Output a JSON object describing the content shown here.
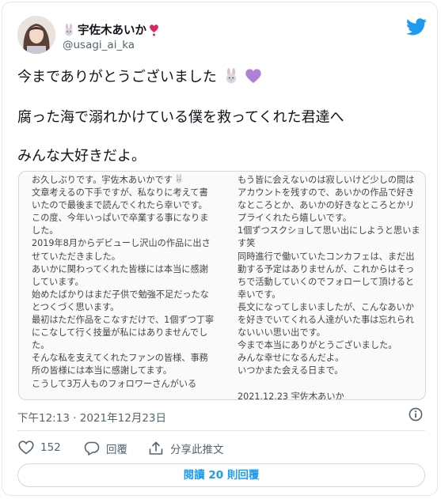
{
  "tweet": {
    "author": {
      "display_name": "宇佐木あいか",
      "handle": "@usagi_ai_ka"
    },
    "lines": [
      "今までありがとうございました",
      "腐った海で溺れかけている僕を救ってくれた君達へ",
      "みんな大好きだよ。"
    ],
    "image_text": {
      "left": [
        "お久しぶりです。宇佐木あいかです",
        "文章考えるの下手ですが、私なりに考えて書",
        "いたので最後まで読んでくれたら幸いです。",
        "この度、今年いっぱいで卒業する事になりま",
        "した。",
        "2019年8月からデビューし沢山の作品に出さ",
        "せていただきました。",
        "あいかに関わってくれた皆様には本当に感謝",
        "しています。",
        "始めたばかりはまだ子供で勉強不足だったな",
        "とつくづく思います。",
        "最初はただ作品をこなすだけで、1個ずつ丁寧",
        "にこなして行く技量が私にはありませんでし",
        "た。",
        "そんな私を支えてくれたファンの皆様、事務",
        "所の皆様には本当に感謝してます。",
        "こうして3万人ものフォロワーさんがいる"
      ],
      "right": [
        "もう皆に会えないのは寂しいけど少しの間は",
        "アカウントを残すので、あいかの作品で好き",
        "なところとか、あいかの好きなところとかリ",
        "プライくれたら嬉しいです。",
        "1個ずつスクショして思い出にしようと思いま",
        "す笑",
        "同時進行で働いていたコンカフェは、まだ出",
        "勤する予定はありませんが、これからはそっ",
        "ちで活動していくのでフォローして頂けると",
        "幸いです。",
        "長文になってしまいましたが、こんなあいか",
        "を好きでいてくれる人達がいた事は忘れられ",
        "ないいい思い出です。",
        "今まで本当にありがとうございました。",
        "みんな幸せになるんだよ。",
        "いつかまた会える日まで。",
        "",
        "2021.12.23  宇佐木あいか"
      ]
    },
    "timestamp": "下午12:13 · 2021年12月23日",
    "like_count": "152",
    "reply_label": "回覆",
    "share_label": "分享此推文",
    "view_replies_label": "閱讀 20 則回覆"
  },
  "colors": {
    "accent": "#1d9bf0",
    "text": "#0f1419",
    "muted": "#536471",
    "border": "#cfd9de",
    "heart_emoji": "#b07fd6",
    "red_heart": "#e0245e"
  },
  "icons": {
    "brand": "twitter-bird-icon",
    "rabbit": "rabbit-emoji-icon",
    "heart": "heart-icon",
    "reply": "reply-bubble-icon",
    "share": "share-upload-icon",
    "info": "info-icon"
  }
}
